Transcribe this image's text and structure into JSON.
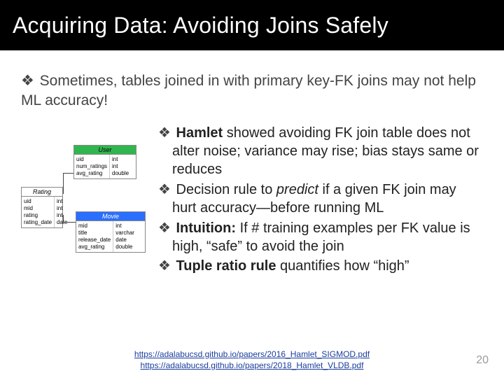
{
  "title": "Acquiring Data: Avoiding Joins Safely",
  "bullet_main": "Sometimes, tables joined in with primary key-FK joins may not help ML accuracy!",
  "sub": {
    "b1_pre": "",
    "b1_bold": "Hamlet",
    "b1_rest": " showed avoiding FK join table does not alter noise; variance may rise; bias stays same or reduces",
    "b2_pre": "Decision rule to ",
    "b2_em": "predict",
    "b2_rest": " if a given FK join may hurt accuracy—before running ML",
    "b3_bold": "Intuition:",
    "b3_rest": " If # training examples per FK value is high, “safe” to avoid the join",
    "b4_bold": "Tuple ratio rule",
    "b4_rest": " quantifies how “high”"
  },
  "tables": {
    "rating": {
      "name": "Rating",
      "cols_l": "uid\nmid\nrating\nrating_date",
      "cols_r": "int\nint\nint\ndate"
    },
    "user": {
      "name": "User",
      "cols_l": "uid\nnum_ratings\navg_rating",
      "cols_r": "int\nint\ndouble"
    },
    "movie": {
      "name": "Movie",
      "cols_l": "mid\ntitle\nrelease_date\navg_rating",
      "cols_r": "int\nvarchar\ndate\ndouble"
    }
  },
  "links": {
    "a": "https://adalabucsd.github.io/papers/2016_Hamlet_SIGMOD.pdf",
    "b": "https://adalabucsd.github.io/papers/2018_Hamlet_VLDB.pdf"
  },
  "page": "20"
}
